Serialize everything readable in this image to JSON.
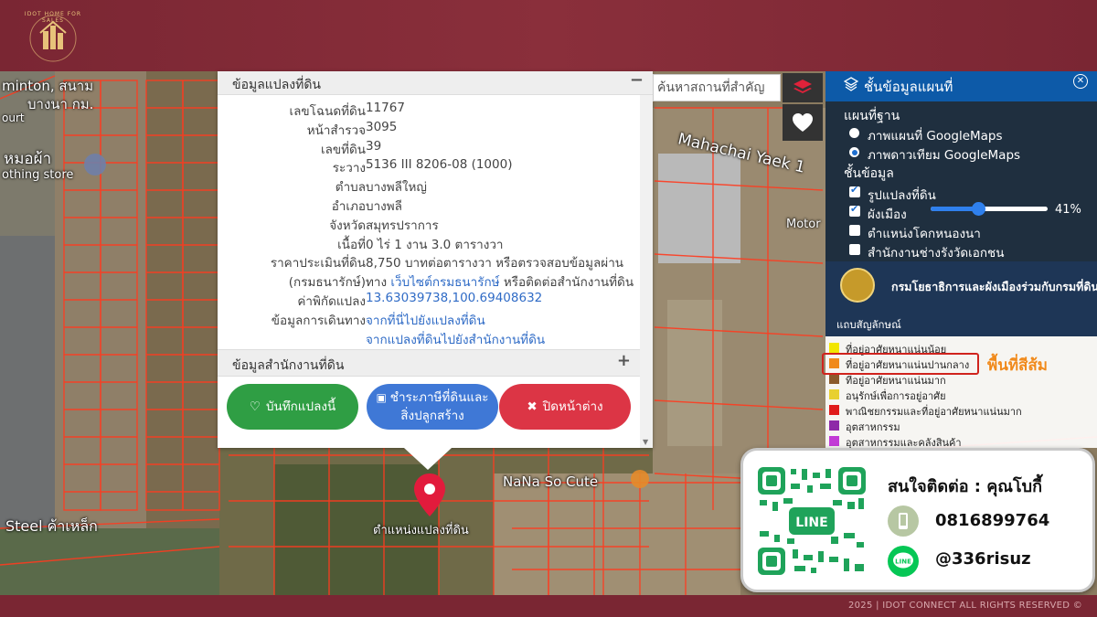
{
  "brand": {
    "logo_text": "IDOT HOME FOR SALES",
    "footer": "2025 | IDOT CONNECT ALL RIGHTS RESERVED ©"
  },
  "map": {
    "labels": [
      "minton, สนาม",
      "บางนา กม.",
      "ourt",
      "หมอผ้า",
      "othing store",
      "Mahachai Yaek 1",
      "Motor",
      "NaNa So Cute",
      "Steel ค้าเหล็ก"
    ],
    "pin_label": "ตำแหน่งแปลงที่ดิน"
  },
  "parcel": {
    "title": "ข้อมูลแปลงที่ดิน",
    "collapse_symbol": "−",
    "rows": [
      {
        "k": "เลขโฉนดที่ดิน",
        "v": "11767"
      },
      {
        "k": "หน้าสำรวจ",
        "v": "3095"
      },
      {
        "k": "เลขที่ดิน",
        "v": "39"
      },
      {
        "k": "ระวาง",
        "v": "5136 III 8206-08 (1000)"
      },
      {
        "k": "ตำบล",
        "v": "บางพลีใหญ่"
      },
      {
        "k": "อำเภอ",
        "v": "บางพลี"
      },
      {
        "k": "จังหวัด",
        "v": "สมุทรปราการ"
      },
      {
        "k": "เนื้อที่",
        "v": "0 ไร่ 1 งาน 3.0 ตารางวา"
      }
    ],
    "price_label": "ราคาประเมินที่ดิน",
    "price_value": "8,750 บาทต่อตารางวา หรือตรวจสอบข้อมูลผ่าน",
    "price_label2": "(กรมธนารักษ์)",
    "price_pre": "ทาง",
    "price_link": "เว็บไซต์กรมธนารักษ์",
    "price_post": "หรือติดต่อสำนักงานที่ดิน",
    "coord_label": "ค่าพิกัดแปลง",
    "coord_value": "13.63039738,100.69408632",
    "travel_label": "ข้อมูลการเดินทาง",
    "travel_link1": "จากที่นี่ไปยังแปลงที่ดิน",
    "travel_link2": "จากแปลงที่ดินไปยังสำนักงานที่ดิน",
    "office_title": "ข้อมูลสำนักงานที่ดิน",
    "expand_symbol": "+",
    "btn_save": "บันทึกแปลงนี้",
    "btn_pay_line1": "ชำระภาษีที่ดินและ",
    "btn_pay_line2": "สิ่งปลูกสร้าง",
    "btn_close": "ปิดหน้าต่าง"
  },
  "search": {
    "placeholder": "ค้นหาสถานที่สำคัญ"
  },
  "layers": {
    "title": "ชั้นข้อมูลแผนที่",
    "basemap_title": "แผนที่ฐาน",
    "basemap_options": [
      {
        "label": "ภาพแผนที่ GoogleMaps",
        "selected": false
      },
      {
        "label": "ภาพดาวเทียม GoogleMaps",
        "selected": true
      }
    ],
    "data_title": "ชั้นข้อมูล",
    "data_options": [
      {
        "label": "รูปแปลงที่ดิน",
        "checked": true
      },
      {
        "label": "ผังเมือง",
        "checked": true
      },
      {
        "label": "ตำแหน่งโคกหนองนา",
        "checked": false
      },
      {
        "label": "สำนักงานช่างรังวัดเอกชน",
        "checked": false
      }
    ],
    "opacity": 41,
    "opacity_label": "41%"
  },
  "dept": {
    "name": "กรมโยธาธิการและผังเมืองร่วมกับกรมที่ดิน"
  },
  "legend": {
    "title": "แถบสัญลักษณ์",
    "items": [
      {
        "label": "ที่อยู่อาศัยหนาแน่นน้อย",
        "color": "#f2e600"
      },
      {
        "label": "ที่อยู่อาศัยหนาแน่นปานกลาง",
        "color": "#f08a1c"
      },
      {
        "label": "ที่อยู่อาศัยหนาแน่นมาก",
        "color": "#8b5a2b"
      },
      {
        "label": "อนุรักษ์เพื่อการอยู่อาศัย",
        "color": "#e8d030"
      },
      {
        "label": "พาณิชยกรรมและที่อยู่อาศัยหนาแน่นมาก",
        "color": "#e01b1b"
      },
      {
        "label": "อุตสาหกรรม",
        "color": "#8e2aa8"
      },
      {
        "label": "อุตสาหกรรมและคลังสินค้า",
        "color": "#c23ad6"
      }
    ],
    "note": "พื้นที่สีส้ม"
  },
  "contact": {
    "title": "สนใจติดต่อ :  คุณโบกี้",
    "phone": "0816899764",
    "line_id": "@336risuz",
    "qr_text": "LINE"
  }
}
